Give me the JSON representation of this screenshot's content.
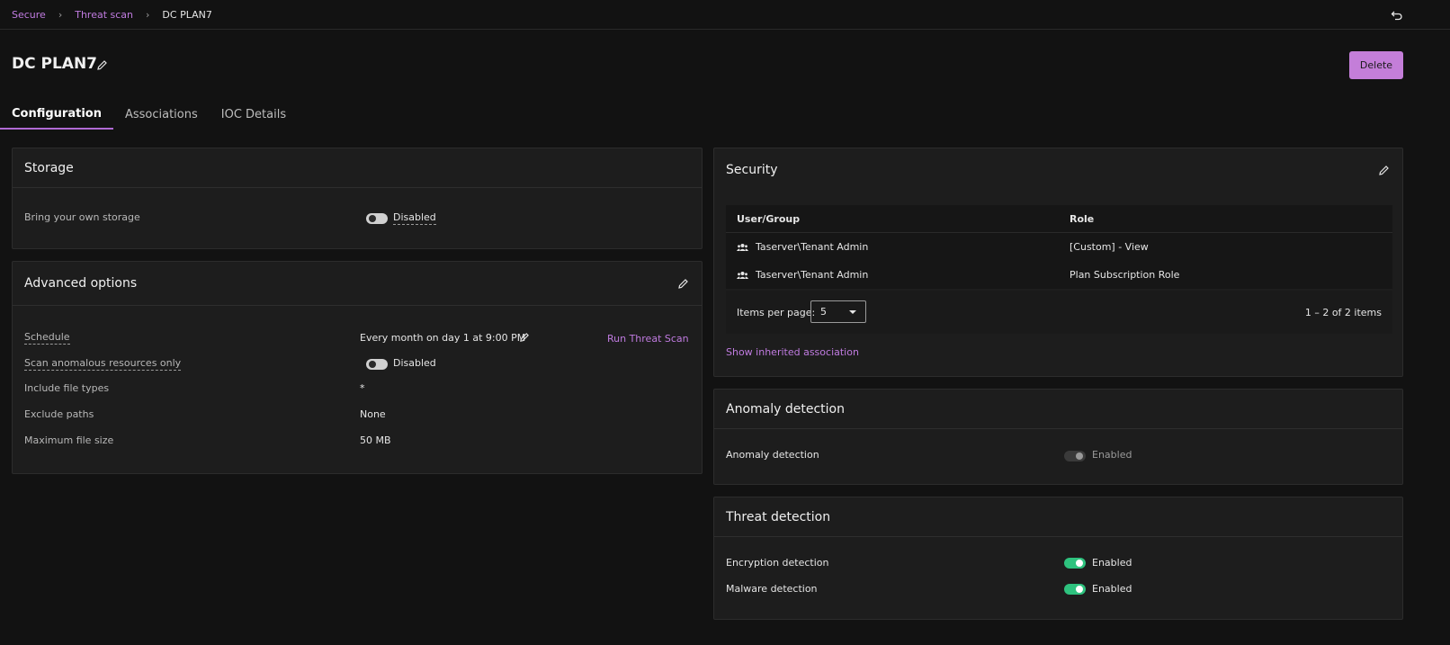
{
  "breadcrumb": {
    "items": [
      "Secure",
      "Threat scan"
    ],
    "current": "DC PLAN7"
  },
  "page": {
    "title": "DC PLAN7",
    "delete_label": "Delete"
  },
  "tabs": [
    {
      "label": "Configuration",
      "active": true
    },
    {
      "label": "Associations",
      "active": false
    },
    {
      "label": "IOC Details",
      "active": false
    }
  ],
  "storage": {
    "title": "Storage",
    "byos_label": "Bring your own storage",
    "byos_state": "Disabled"
  },
  "advanced": {
    "title": "Advanced options",
    "schedule_label": "Schedule",
    "schedule_value": "Every month on day 1 at 9:00 PM",
    "run_label": "Run Threat Scan",
    "anomalous_label": "Scan anomalous resources only",
    "anomalous_state": "Disabled",
    "include_label": "Include file types",
    "include_value": "*",
    "exclude_label": "Exclude paths",
    "exclude_value": "None",
    "maxsize_label": "Maximum file size",
    "maxsize_value": "50 MB"
  },
  "security": {
    "title": "Security",
    "col_user": "User/Group",
    "col_role": "Role",
    "rows": [
      {
        "user": "Taserver\\Tenant Admin",
        "role": "[Custom] - View"
      },
      {
        "user": "Taserver\\Tenant Admin",
        "role": "Plan Subscription Role"
      }
    ],
    "items_per_page_label": "Items per page:",
    "items_per_page": "5",
    "count": "1 – 2 of 2 items",
    "inherited_link": "Show inherited association"
  },
  "anomaly": {
    "title": "Anomaly detection",
    "label": "Anomaly detection",
    "state": "Enabled"
  },
  "threat": {
    "title": "Threat detection",
    "encryption_label": "Encryption detection",
    "encryption_state": "Enabled",
    "malware_label": "Malware detection",
    "malware_state": "Enabled"
  },
  "colors": {
    "accent": "#c47ed9",
    "toggle_on": "#2ec27e",
    "background": "#121212",
    "card": "#1d1d1d"
  }
}
